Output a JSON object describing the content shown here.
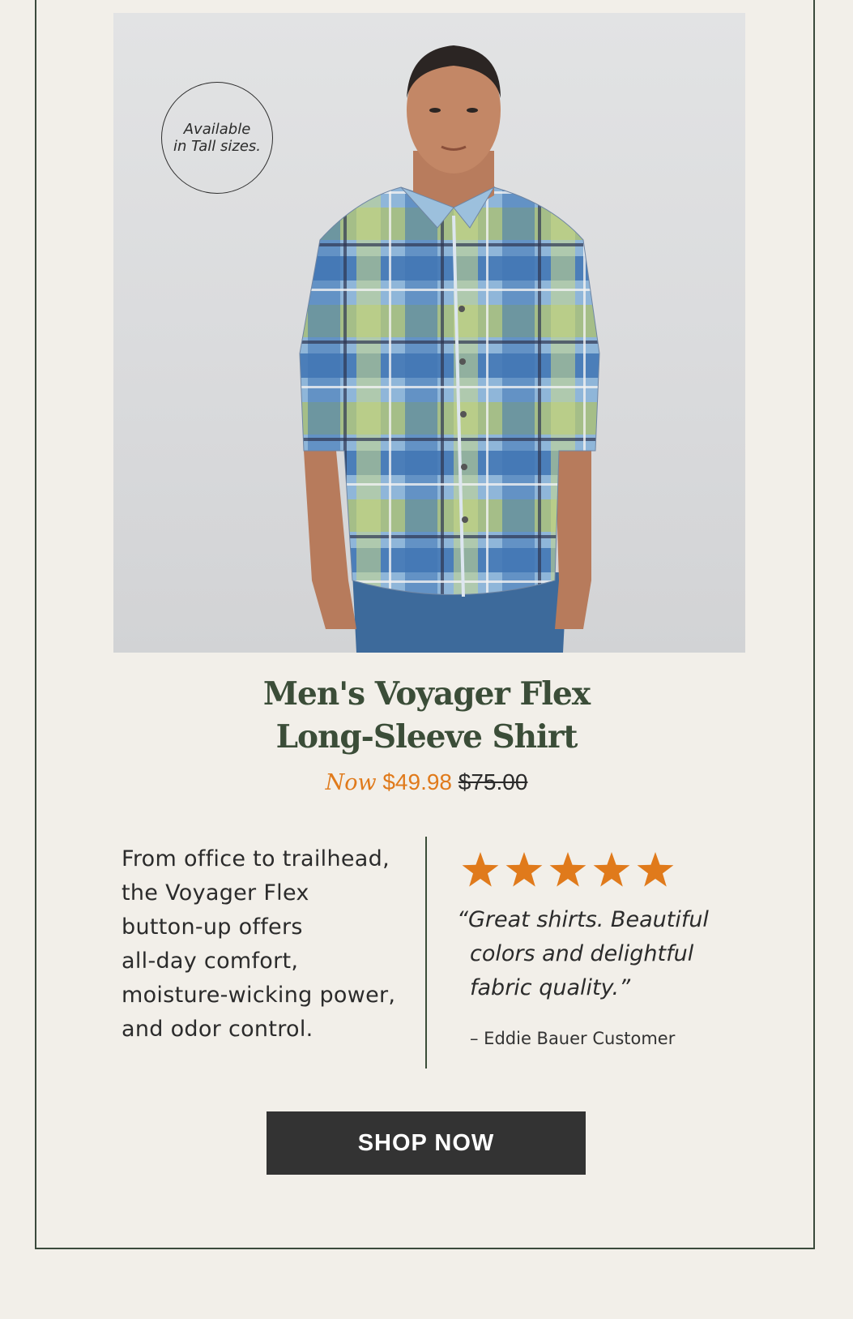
{
  "badge": {
    "line1": "Available",
    "line2": "in Tall sizes."
  },
  "product": {
    "title_line1": "Men's Voyager Flex",
    "title_line2": "Long-Sleeve Shirt",
    "now_label": "Now",
    "now_price": "$49.98",
    "old_price": "$75.00"
  },
  "description": {
    "lines": [
      "From office to trailhead,",
      "the Voyager Flex",
      "button-up offers",
      "all-day comfort,",
      "moisture-wicking power,",
      "and odor control."
    ]
  },
  "review": {
    "rating": 5,
    "max_rating": 5,
    "quote_lines": [
      "“Great shirts. Beautiful",
      "colors and delightful",
      "fabric quality.”"
    ],
    "attribution": "– Eddie Bauer Customer"
  },
  "cta": {
    "label": "SHOP NOW"
  },
  "colors": {
    "accent_orange": "#e07a1b",
    "title_green": "#3b4d38",
    "button_dark": "#333333",
    "background": "#f2efe9"
  }
}
